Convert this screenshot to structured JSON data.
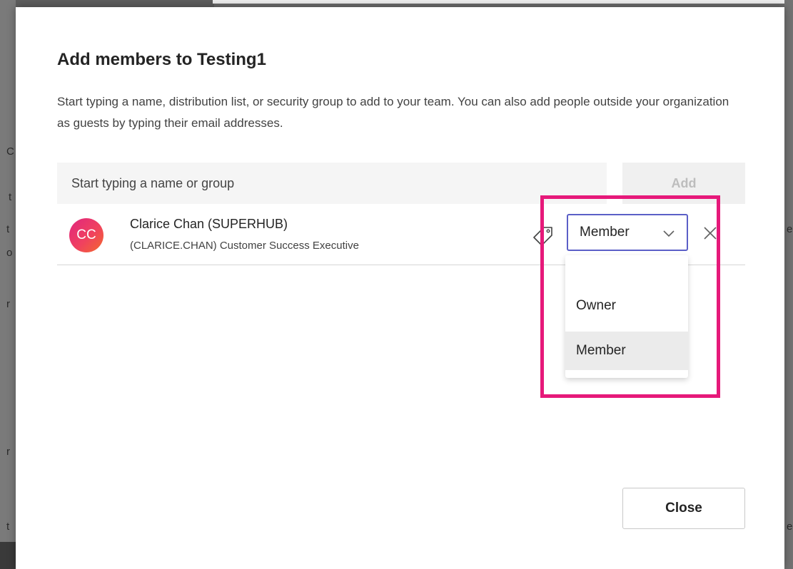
{
  "background": {
    "fragments": [
      "C",
      "t",
      "t",
      "o",
      "r",
      "e",
      "r",
      "t",
      "e"
    ]
  },
  "dialog": {
    "title": "Add members to Testing1",
    "description": "Start typing a name, distribution list, or security group to add to your team. You can also add people outside your organization as guests by typing their email addresses.",
    "search": {
      "value": "",
      "placeholder": "Start typing a name or group"
    },
    "add_label": "Add",
    "close_label": "Close"
  },
  "member": {
    "initials": "CC",
    "name": "Clarice Chan (SUPERHUB)",
    "detail": "(CLARICE.CHAN) Customer Success Executive",
    "role": "Member",
    "avatar_gradient": [
      "#e0267f",
      "#f36a2c"
    ]
  },
  "role_menu": {
    "options": [
      "Owner",
      "Member"
    ],
    "selected": "Member"
  },
  "colors": {
    "accent": "#5b5fc7",
    "highlight": "#e6197a"
  },
  "icons": [
    "tag-icon",
    "chevron-down-icon",
    "close-icon"
  ]
}
